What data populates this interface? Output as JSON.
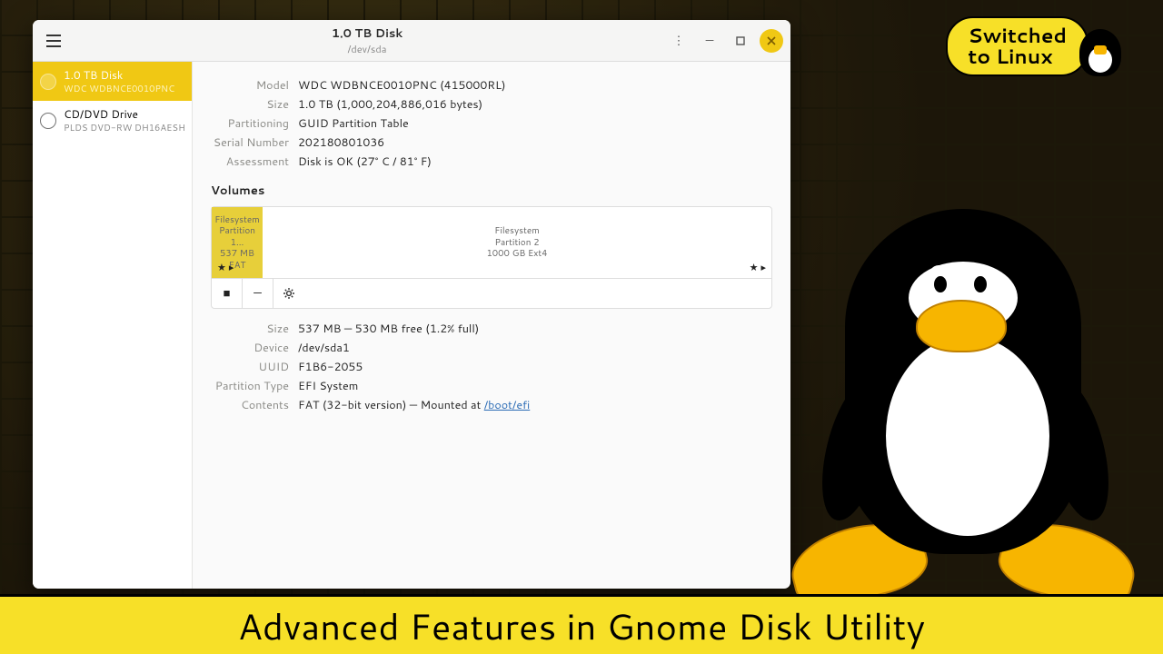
{
  "logo": {
    "line1": "Switched",
    "line2": "to Linux"
  },
  "caption": "Advanced Features in Gnome Disk Utility",
  "titlebar": {
    "title": "1.0 TB Disk",
    "subtitle": "/dev/sda"
  },
  "sidebar": {
    "items": [
      {
        "title": "1.0 TB Disk",
        "sub": "WDC WDBNCE0010PNC"
      },
      {
        "title": "CD/DVD Drive",
        "sub": "PLDS DVD-RW DH16AESH"
      }
    ]
  },
  "details": {
    "model_label": "Model",
    "model": "WDC WDBNCE0010PNC (415000RL)",
    "size_label": "Size",
    "size": "1.0 TB (1,000,204,886,016 bytes)",
    "part_label": "Partitioning",
    "part": "GUID Partition Table",
    "serial_label": "Serial Number",
    "serial": "202180801036",
    "assess_label": "Assessment",
    "assess": "Disk is OK (27° C / 81° F)"
  },
  "volumes": {
    "heading": "Volumes",
    "items": [
      {
        "l1": "Filesystem",
        "l2": "Partition 1…",
        "l3": "537 MB FAT"
      },
      {
        "l1": "Filesystem",
        "l2": "Partition 2",
        "l3": "1000 GB Ext4"
      }
    ]
  },
  "selected": {
    "size_label": "Size",
    "size": "537 MB — 530 MB free (1.2% full)",
    "device_label": "Device",
    "device": "/dev/sda1",
    "uuid_label": "UUID",
    "uuid": "F1B6-2055",
    "ptype_label": "Partition Type",
    "ptype": "EFI System",
    "contents_label": "Contents",
    "contents_pre": "FAT (32-bit version) — Mounted at ",
    "mount": "/boot/efi"
  }
}
